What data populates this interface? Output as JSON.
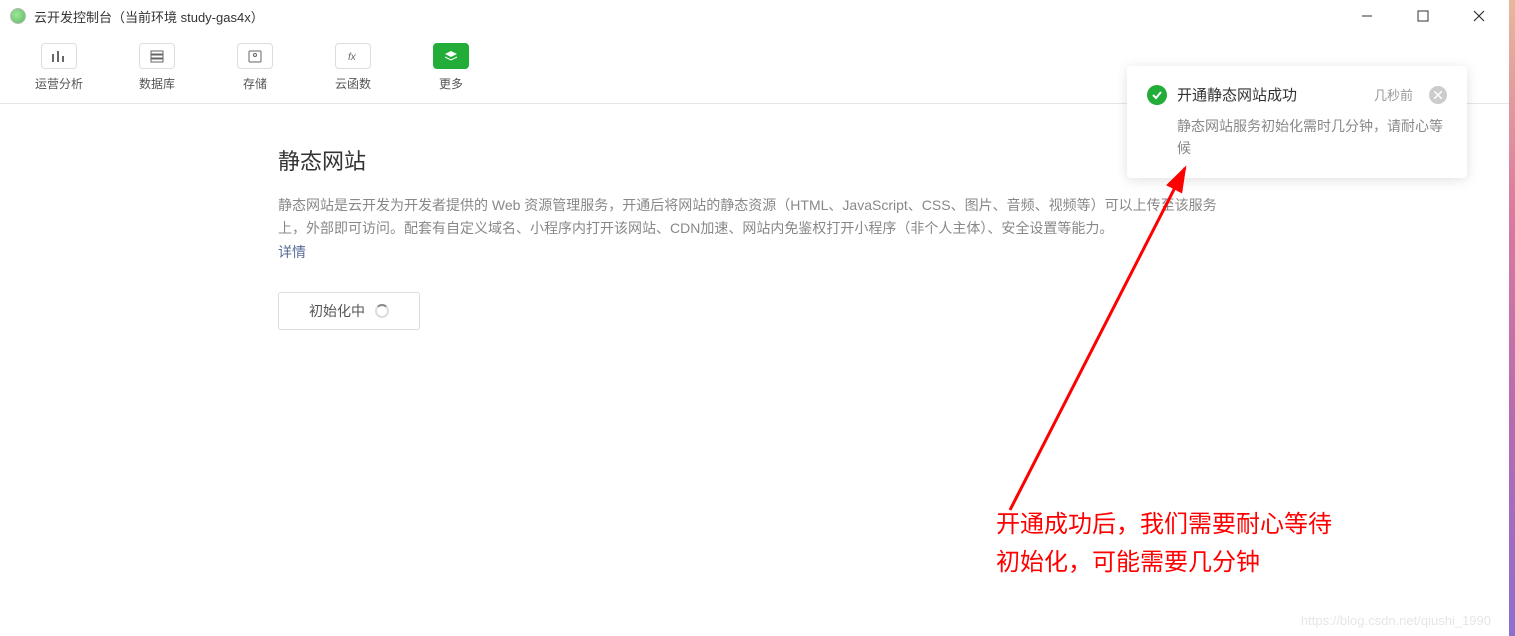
{
  "window": {
    "title": "云开发控制台（当前环境 study-gas4x）"
  },
  "toolbar": {
    "items": [
      {
        "label": "运营分析",
        "icon": "bar-chart"
      },
      {
        "label": "数据库",
        "icon": "database"
      },
      {
        "label": "存储",
        "icon": "storage"
      },
      {
        "label": "云函数",
        "icon": "function"
      },
      {
        "label": "更多",
        "icon": "layers",
        "active": true
      }
    ]
  },
  "page": {
    "title": "静态网站",
    "desc": "静态网站是云开发为开发者提供的 Web 资源管理服务，开通后将网站的静态资源（HTML、JavaScript、CSS、图片、音频、视频等）可以上传至该服务上，外部即可访问。配套有自定义域名、小程序内打开该网站、CDN加速、网站内免鉴权打开小程序（非个人主体）、安全设置等能力。",
    "details_label": "详情",
    "init_button": "初始化中"
  },
  "toast": {
    "title": "开通静态网站成功",
    "time": "几秒前",
    "body": "静态网站服务初始化需时几分钟，请耐心等候"
  },
  "annotation": {
    "text_line1": "开通成功后，我们需要耐心等待",
    "text_line2": "初始化，可能需要几分钟"
  },
  "watermark": "https://blog.csdn.net/qiushi_1990"
}
